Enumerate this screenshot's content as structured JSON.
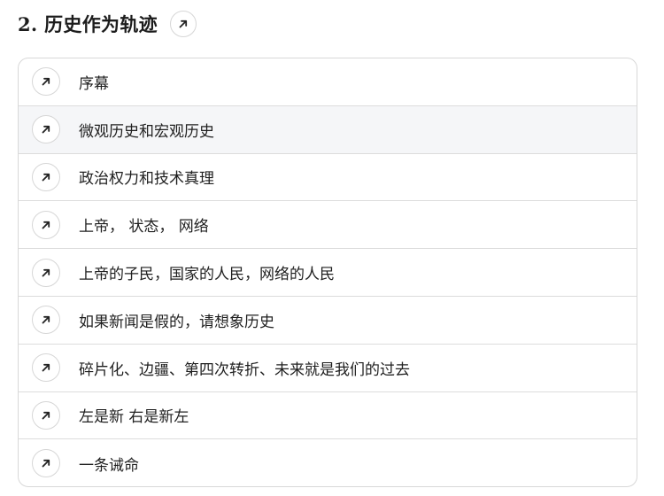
{
  "section": {
    "title": "2. 历史作为轨迹"
  },
  "icons": {
    "title_link": "arrow-up-right-icon",
    "item_link": "arrow-up-right-icon"
  },
  "colors": {
    "border": "#d8d8d8",
    "hover_background": "#f5f6f8",
    "text": "#1f1f1f"
  },
  "items": [
    {
      "label": "序幕",
      "hovered": false
    },
    {
      "label": "微观历史和宏观历史",
      "hovered": true
    },
    {
      "label": "政治权力和技术真理",
      "hovered": false
    },
    {
      "label": "上帝， 状态， 网络",
      "hovered": false
    },
    {
      "label": "上帝的子民，国家的人民，网络的人民",
      "hovered": false
    },
    {
      "label": "如果新闻是假的，请想象历史",
      "hovered": false
    },
    {
      "label": "碎片化、边疆、第四次转折、未来就是我们的过去",
      "hovered": false
    },
    {
      "label": "左是新 右是新左",
      "hovered": false
    },
    {
      "label": "一条诫命",
      "hovered": false
    }
  ]
}
